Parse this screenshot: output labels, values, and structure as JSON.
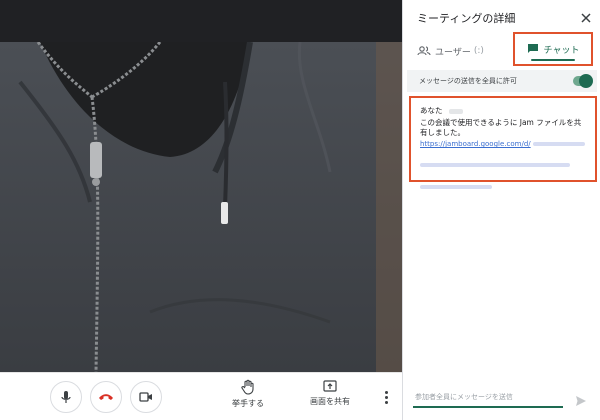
{
  "panel": {
    "title": "ミーティングの詳細",
    "tabs": {
      "users_label": "ユーザー",
      "users_count": "(:)",
      "chat_label": "チャット"
    },
    "allow_messages_label": "メッセージの送信を全員に許可",
    "allow_messages_on": true,
    "message": {
      "sender": "あなた",
      "body": "この会議で使用できるように Jam ファイルを共有しました。",
      "link_text": "https://jamboard.google.com/d/"
    },
    "input_placeholder": "参加者全員にメッセージを送信"
  },
  "controls": {
    "raise_hand_label": "挙手する",
    "share_screen_label": "画面を共有"
  },
  "colors": {
    "accent_green": "#1e6b52",
    "highlight_orange": "#e0522c",
    "end_call_red": "#d93025",
    "link_blue": "#3b6fd0"
  },
  "icons": [
    "close-icon",
    "people-icon",
    "chat-icon",
    "mic-icon",
    "end-call-icon",
    "camera-icon",
    "hand-icon",
    "present-icon",
    "more-vert-icon",
    "send-icon"
  ]
}
